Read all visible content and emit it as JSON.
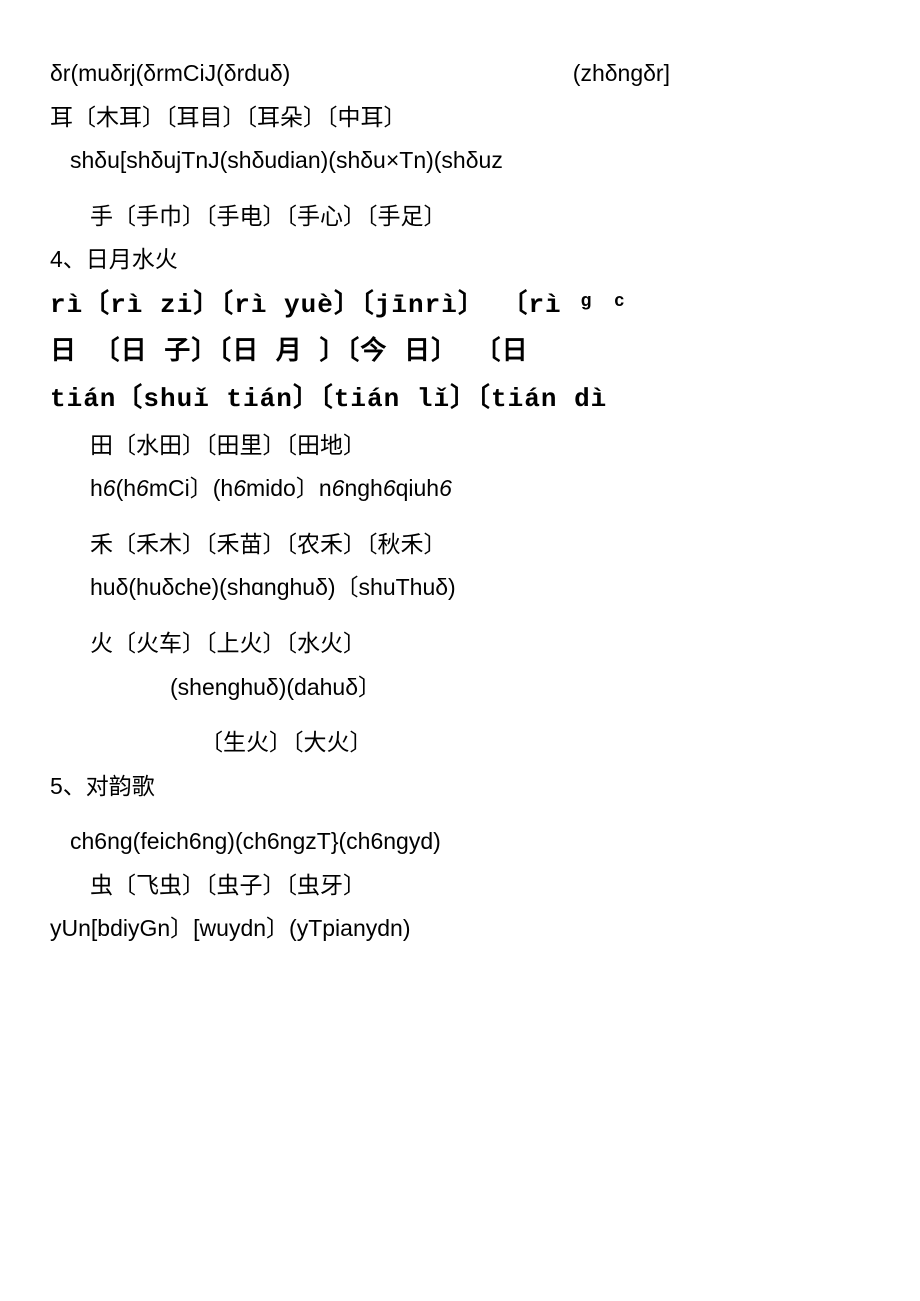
{
  "lines": {
    "l1a": "δr(muδrj(δrmCiJ(δrduδ)",
    "l1b": "(zhδngδr]",
    "l2": "耳〔木耳〕〔耳目〕〔耳朵〕〔中耳〕",
    "l3": "shδu[shδujTnJ(shδudian)(shδu×Tn)(shδuz",
    "l4": "手〔手巾〕〔手电〕〔手心〕〔手足〕",
    "l5": "4、日月水火",
    "l6": "rì〔rì zi〕〔rì yuè〕〔jīnrì〕 〔rì ᵍ ᶜ",
    "l7": "日 〔日 子〕〔日 月 〕〔今  日〕  〔日",
    "l8": "tián〔shuǐ tián〕〔tián lǐ〕〔tián dì",
    "l9": "田〔水田〕〔田里〕〔田地〕",
    "l10": "h6(h6mCi〕(h6mido〕n6ngh6qiuh6",
    "l11": "禾〔禾木〕〔禾苗〕〔农禾〕〔秋禾〕",
    "l12": "huδ(huδche)(shɑnghuδ)〔shuThuδ)",
    "l13": "火〔火车〕〔上火〕〔水火〕",
    "l14": "(shenghuδ)(dahuδ〕",
    "l15": "〔生火〕〔大火〕",
    "l16": "5、对韵歌",
    "l17": "ch6ng(feich6ng)(ch6ngzT}(ch6ngyd)",
    "l18": "虫〔飞虫〕〔虫子〕〔虫牙〕",
    "l19": "yUn[bdiyGn〕[wuydn〕(yTpianydn)"
  }
}
